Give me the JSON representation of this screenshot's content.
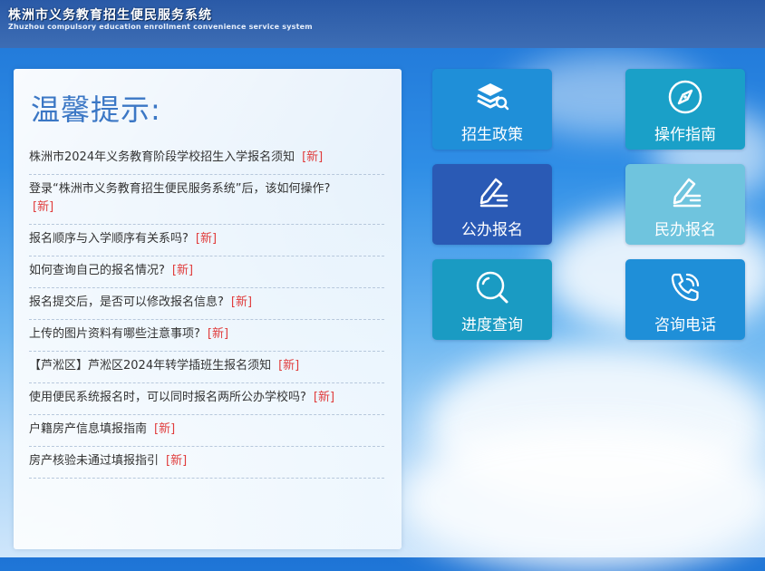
{
  "header": {
    "title": "株洲市义务教育招生便民服务系统",
    "subtitle": "Zhuzhou compulsory education enrollment convenience service system"
  },
  "notice": {
    "heading": "温馨提示:",
    "new_tag": "[新]",
    "items": [
      "株洲市2024年义务教育阶段学校招生入学报名须知",
      "登录“株洲市义务教育招生便民服务系统”后，该如何操作?",
      "报名顺序与入学顺序有关系吗?",
      "如何查询自己的报名情况?",
      "报名提交后，是否可以修改报名信息?",
      "上传的图片资料有哪些注意事项?",
      "【芦淞区】芦淞区2024年转学插班生报名须知",
      "使用便民系统报名时，可以同时报名两所公办学校吗?",
      "户籍房产信息填报指南",
      "房产核验未通过填报指引"
    ]
  },
  "tiles": {
    "policy": {
      "label": "招生政策",
      "icon": "stack-search-icon",
      "color": "#1f8fd8"
    },
    "guide": {
      "label": "操作指南",
      "icon": "compass-icon",
      "color": "#1aa0c8"
    },
    "public": {
      "label": "公办报名",
      "icon": "pen-form-icon",
      "color": "#2a5ab5"
    },
    "private": {
      "label": "民办报名",
      "icon": "pen-form-icon",
      "color": "#6fc4de"
    },
    "progress": {
      "label": "进度查询",
      "icon": "magnifier-icon",
      "color": "#1a9bc3"
    },
    "phone": {
      "label": "咨询电话",
      "icon": "phone-icon",
      "color": "#1f8fd8"
    }
  }
}
